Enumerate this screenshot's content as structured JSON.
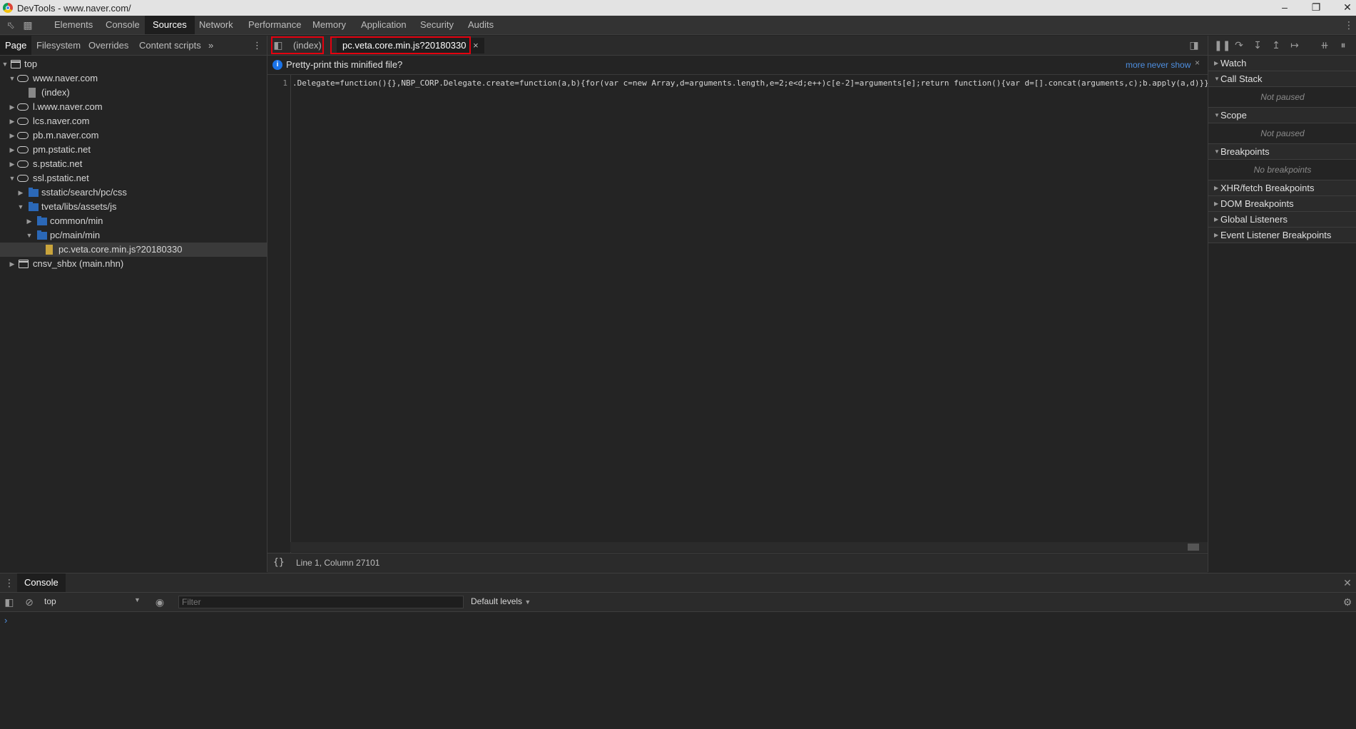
{
  "window": {
    "title": "DevTools - www.naver.com/"
  },
  "main_tabs": [
    "Elements",
    "Console",
    "Sources",
    "Network",
    "Performance",
    "Memory",
    "Application",
    "Security",
    "Audits"
  ],
  "active_main_tab": "Sources",
  "navigator": {
    "tabs": [
      "Page",
      "Filesystem",
      "Overrides",
      "Content scripts"
    ],
    "more_tabs_glyph": "»",
    "tree": [
      {
        "label": "top",
        "icon": "frame-icon",
        "expanded": true
      },
      {
        "label": "www.naver.com",
        "icon": "cloud-icon",
        "expanded": true
      },
      {
        "label": "(index)",
        "icon": "file-icon"
      },
      {
        "label": "l.www.naver.com",
        "icon": "cloud-icon",
        "expanded": false
      },
      {
        "label": "lcs.naver.com",
        "icon": "cloud-icon",
        "expanded": false
      },
      {
        "label": "pb.m.naver.com",
        "icon": "cloud-icon",
        "expanded": false
      },
      {
        "label": "pm.pstatic.net",
        "icon": "cloud-icon",
        "expanded": false
      },
      {
        "label": "s.pstatic.net",
        "icon": "cloud-icon",
        "expanded": false
      },
      {
        "label": "ssl.pstatic.net",
        "icon": "cloud-icon",
        "expanded": true
      },
      {
        "label": "sstatic/search/pc/css",
        "icon": "folder-icon",
        "expanded": false
      },
      {
        "label": "tveta/libs/assets/js",
        "icon": "folder-icon",
        "expanded": true
      },
      {
        "label": "common/min",
        "icon": "folder-icon",
        "expanded": false
      },
      {
        "label": "pc/main/min",
        "icon": "folder-icon",
        "expanded": true
      },
      {
        "label": "pc.veta.core.min.js?20180330",
        "icon": "js-file-icon",
        "selected": true
      },
      {
        "label": "cnsv_shbx (main.nhn)",
        "icon": "frame-icon",
        "expanded": false
      }
    ]
  },
  "editor": {
    "tabs": [
      {
        "label": "(index)",
        "active": false
      },
      {
        "label": "pc.veta.core.min.js?20180330",
        "active": true,
        "close": "×"
      }
    ],
    "infobar": {
      "message": "Pretty-print this minified file?",
      "more_link": "more",
      "never_show_link": "never show",
      "close": "×"
    },
    "line_number": "1",
    "code_line": ".Delegate=function(){},NBP_CORP.Delegate.create=function(a,b){for(var c=new Array,d=arguments.length,e=2;e<d;e++)c[e-2]=arguments[e];return function(){var d=[].concat(arguments,c);b.apply(a,d)}};",
    "status": {
      "braces": "{}",
      "position": "Line 1, Column 27101"
    }
  },
  "debugger": {
    "panes": [
      {
        "title": "Watch",
        "expanded": false
      },
      {
        "title": "Call Stack",
        "expanded": true,
        "body": "Not paused"
      },
      {
        "title": "Scope",
        "expanded": true,
        "body": "Not paused"
      },
      {
        "title": "Breakpoints",
        "expanded": true,
        "body": "No breakpoints"
      },
      {
        "title": "XHR/fetch Breakpoints",
        "expanded": false
      },
      {
        "title": "DOM Breakpoints",
        "expanded": false
      },
      {
        "title": "Global Listeners",
        "expanded": false
      },
      {
        "title": "Event Listener Breakpoints",
        "expanded": false
      }
    ]
  },
  "drawer": {
    "tab": "Console",
    "context": "top",
    "filter_placeholder": "Filter",
    "levels": "Default levels",
    "prompt": "›"
  },
  "colors": {
    "highlight_box": "#e3000f",
    "link": "#4e8fe0",
    "info_icon": "#1a73e8"
  }
}
